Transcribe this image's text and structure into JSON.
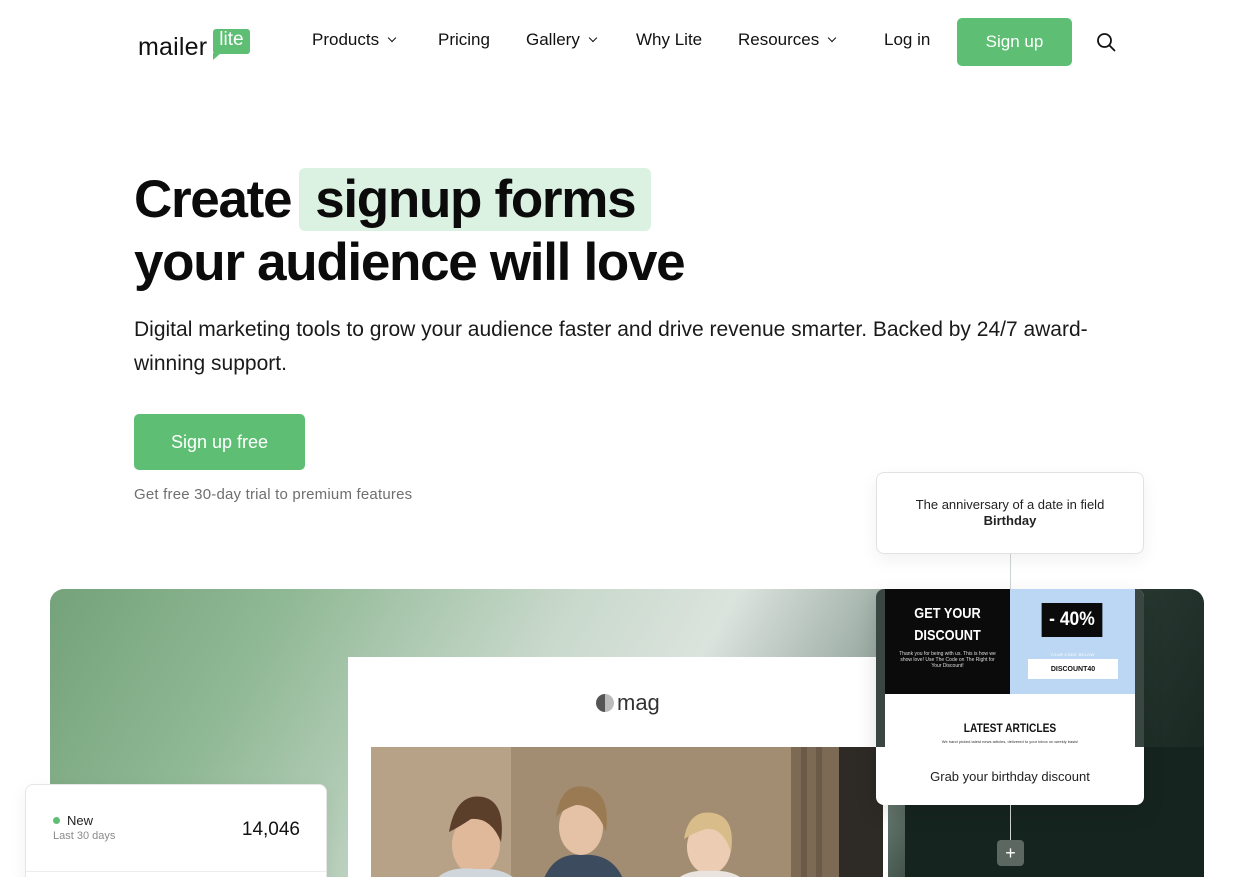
{
  "nav": {
    "logo": {
      "word": "mailer",
      "badge": "lite"
    },
    "items": [
      {
        "label": "Products",
        "has_dropdown": true
      },
      {
        "label": "Pricing",
        "has_dropdown": false
      },
      {
        "label": "Gallery",
        "has_dropdown": true
      },
      {
        "label": "Why Lite",
        "has_dropdown": false
      },
      {
        "label": "Resources",
        "has_dropdown": true
      }
    ],
    "login_label": "Log in",
    "signup_label": "Sign up",
    "search_icon": "search-icon"
  },
  "hero": {
    "title_prefix": "Create",
    "title_highlight": "signup forms",
    "title_line2": "your audience will love",
    "subtitle": "Digital marketing tools to grow your audience faster and drive revenue smarter. Backed by 24/7 award-winning support.",
    "cta_label": "Sign up free",
    "trial_note": "Get free 30-day trial to premium features"
  },
  "showcase": {
    "mag_logo": "mag",
    "trigger": {
      "text": "The anniversary of a date in field",
      "field": "Birthday"
    },
    "email": {
      "headline": "GET YOUR DISCOUNT",
      "fine_print": "Thank you for being with us. This is how we show love! Use The Code on The Right for Your Discount!",
      "percent": "- 40%",
      "code_label": "YOUR CODE BELOW",
      "code": "DISCOUNT40",
      "section_title": "LATEST ARTICLES",
      "section_line": "We hand picked latest news articles, delivered to your inbox on weekly basis!",
      "caption": "Grab your birthday discount"
    },
    "add_step_icon": "plus-icon",
    "stats": {
      "label": "New",
      "period": "Last 30 days",
      "value": "14,046"
    }
  },
  "colors": {
    "brand_green": "#5ebf74",
    "highlight": "#dbf1e1"
  }
}
